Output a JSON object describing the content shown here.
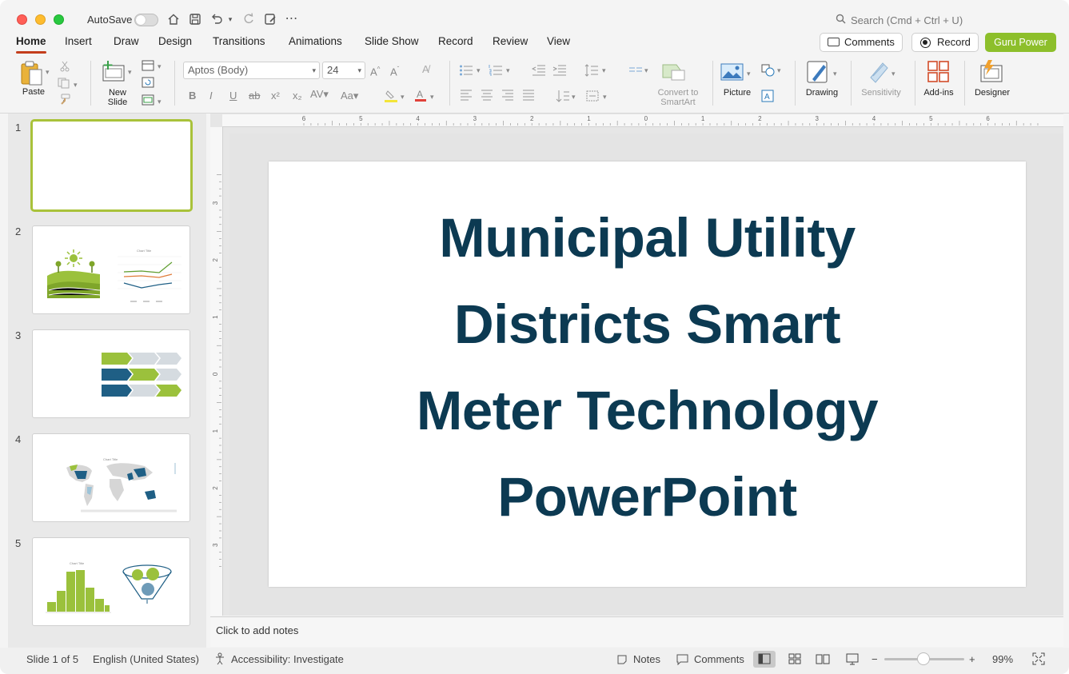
{
  "titlebar": {
    "autosave_label": "AutoSave",
    "search_placeholder": "Search (Cmd + Ctrl + U)"
  },
  "tabs": [
    "Home",
    "Insert",
    "Draw",
    "Design",
    "Transitions",
    "Animations",
    "Slide Show",
    "Record",
    "Review",
    "View"
  ],
  "header_buttons": {
    "comments": "Comments",
    "record": "Record",
    "guru": "Guru Power"
  },
  "ribbon": {
    "paste": "Paste",
    "new_slide_1": "New",
    "new_slide_2": "Slide",
    "font_name": "Aptos (Body)",
    "font_size": "24",
    "convert_smartart_1": "Convert to",
    "convert_smartart_2": "SmartArt",
    "picture": "Picture",
    "drawing": "Drawing",
    "sensitivity": "Sensitivity",
    "add_ins": "Add-ins",
    "designer": "Designer"
  },
  "slides": [
    {
      "num": "1"
    },
    {
      "num": "2"
    },
    {
      "num": "3"
    },
    {
      "num": "4"
    },
    {
      "num": "5"
    }
  ],
  "thumb_text": {
    "chart_title": "Chart Title"
  },
  "slide": {
    "title_line1": "Municipal Utility",
    "title_line2": "Districts Smart",
    "title_line3": "Meter Technology",
    "title_line4": "PowerPoint"
  },
  "ruler": {
    "h_labels": [
      "6",
      "5",
      "4",
      "3",
      "2",
      "1",
      "0",
      "1",
      "2",
      "3",
      "4",
      "5",
      "6"
    ],
    "v_labels": [
      "3",
      "2",
      "1",
      "0",
      "1",
      "2",
      "3"
    ]
  },
  "notes_placeholder": "Click to add notes",
  "status": {
    "slide_count": "Slide 1 of 5",
    "language": "English (United States)",
    "accessibility": "Accessibility: Investigate",
    "notes": "Notes",
    "comments": "Comments",
    "zoom_minus": "−",
    "zoom_plus": "+",
    "zoom_level": "99%"
  },
  "colors": {
    "accent_tab": "#c43e1c",
    "guru_green": "#8dbf2b",
    "title_navy": "#0c3a52",
    "thumb_green": "#9bc13c",
    "thumb_blue": "#1f5f85"
  }
}
